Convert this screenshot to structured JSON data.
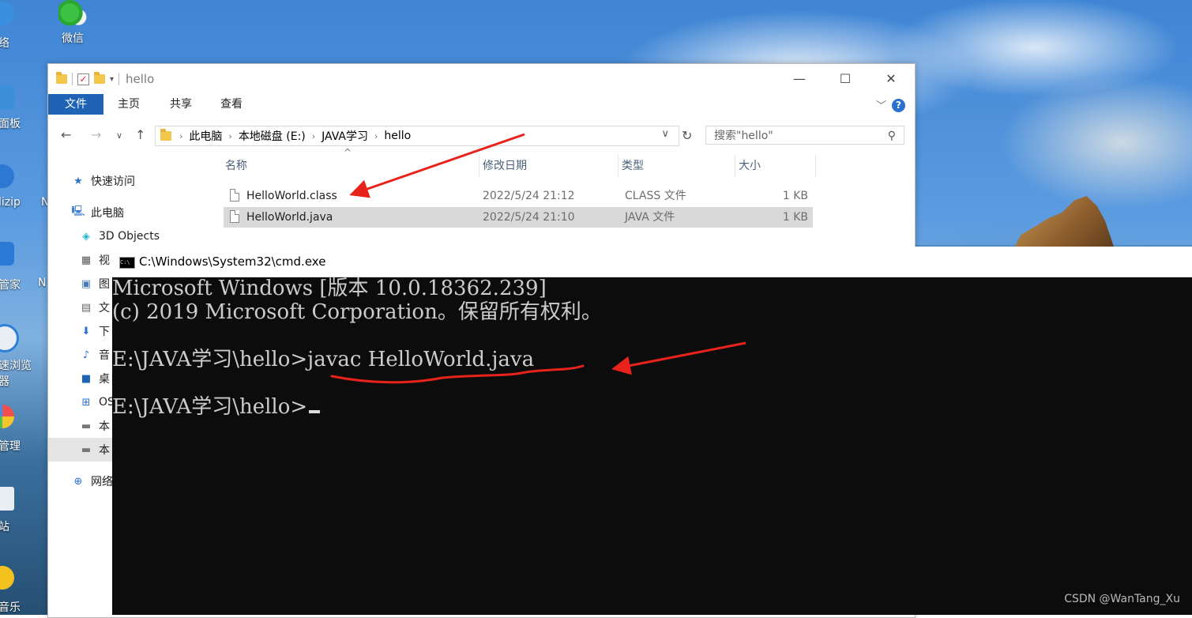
{
  "desktop": {
    "icons": [
      {
        "label": "微信"
      }
    ],
    "edge_labels": [
      "络",
      "面板",
      "lizip",
      "N",
      "管家",
      "N",
      "速浏览",
      "器",
      "管理",
      "站",
      "音乐"
    ]
  },
  "explorer": {
    "title": "hello",
    "ribbon_tabs": [
      "文件",
      "主页",
      "共享",
      "查看"
    ],
    "breadcrumb": [
      "此电脑",
      "本地磁盘 (E:)",
      "JAVA学习",
      "hello"
    ],
    "search_placeholder": "搜索\"hello\"",
    "sidebar": {
      "quick_access": "快速访问",
      "this_pc": "此电脑",
      "items": [
        "3D Objects",
        "视",
        "图",
        "文",
        "下",
        "音",
        "桌",
        "OS",
        "本",
        "本"
      ],
      "network": "网络"
    },
    "columns": [
      "名称",
      "修改日期",
      "类型",
      "大小"
    ],
    "files": [
      {
        "name": "HelloWorld.class",
        "date": "2022/5/24 21:12",
        "type": "CLASS 文件",
        "size": "1 KB"
      },
      {
        "name": "HelloWorld.java",
        "date": "2022/5/24 21:10",
        "type": "JAVA 文件",
        "size": "1 KB"
      }
    ]
  },
  "cmd": {
    "title": "C:\\Windows\\System32\\cmd.exe",
    "icon_text": "C:\\",
    "lines": [
      "Microsoft Windows [版本 10.0.18362.239]",
      "(c) 2019 Microsoft Corporation。保留所有权利。",
      "",
      "E:\\JAVA学习\\hello>javac HelloWorld.java",
      "",
      "E:\\JAVA学习\\hello>"
    ]
  },
  "watermark": "CSDN @WanTang_Xu",
  "annotation_color": "#e8231b"
}
